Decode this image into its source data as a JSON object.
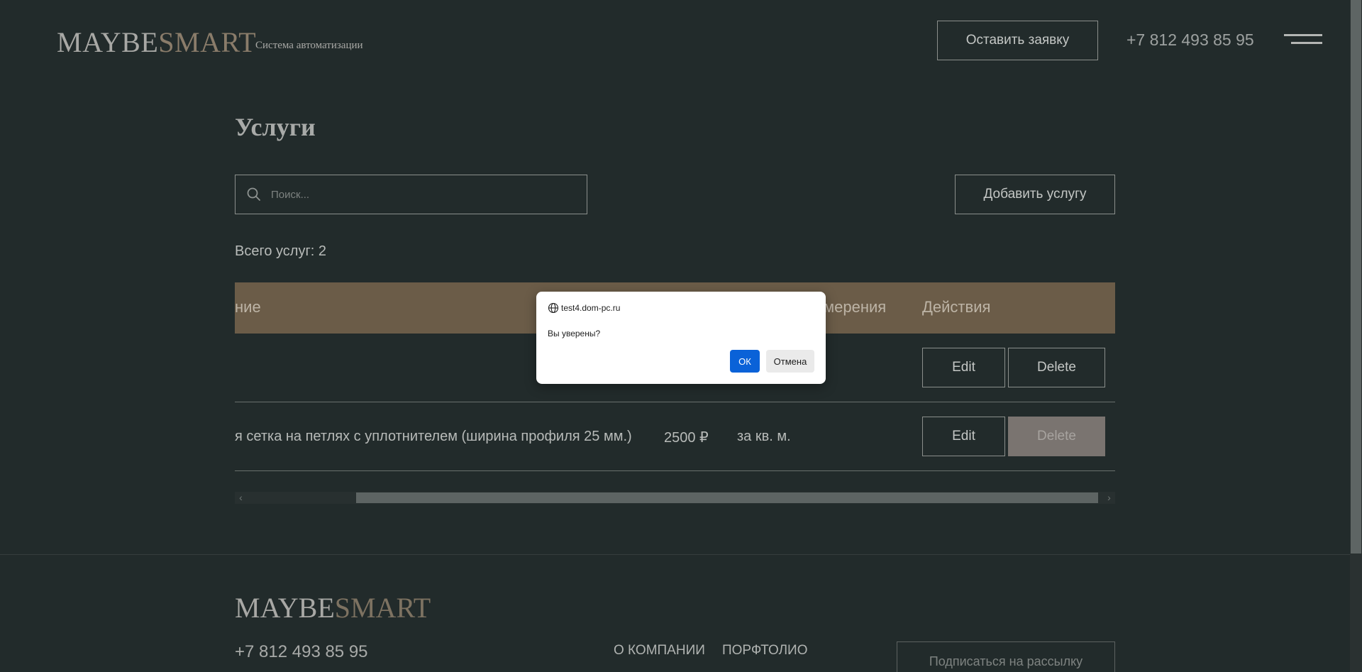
{
  "header": {
    "logo_part1": "MAYBE",
    "logo_part2": "SMART",
    "tagline": "Система автоматизации",
    "cta_label": "Оставить заявку",
    "phone": "+7 812 493 85 95"
  },
  "page": {
    "title": "Услуги",
    "search_placeholder": "Поиск...",
    "add_button_label": "Добавить услугу",
    "total_label": "Всего услуг: 2"
  },
  "table": {
    "headers": {
      "name": "ние",
      "unit": "мерения",
      "actions": "Действия"
    },
    "rows": [
      {
        "name": "",
        "price": "",
        "unit": "",
        "edit_label": "Edit",
        "delete_label": "Delete"
      },
      {
        "name": "я сетка на петлях с уплотнителем (ширина профиля 25 мм.)",
        "price": "2500 ₽",
        "unit": "за кв. м.",
        "edit_label": "Edit",
        "delete_label": "Delete"
      }
    ],
    "scroll_left_arrow": "‹",
    "scroll_right_arrow": "›"
  },
  "footer": {
    "logo_part1": "MAYBE",
    "logo_part2": "SMART",
    "phone": "+7 812 493 85 95",
    "nav": [
      "О КОМПАНИИ",
      "ПОРФТОЛИО"
    ],
    "subscribe_label": "Подписаться на рассылку"
  },
  "dialog": {
    "origin": "test4.dom-pc.ru",
    "message": "Вы уверены?",
    "ok_label": "ОК",
    "cancel_label": "Отмена"
  },
  "colors": {
    "background": "#222b2b",
    "table_header": "#6b5c48",
    "accent_brown": "#8a7c6a",
    "dialog_ok": "#0a62d8"
  },
  "icons": {
    "search": "search-icon",
    "globe": "globe-icon",
    "menu": "hamburger-menu-icon"
  }
}
